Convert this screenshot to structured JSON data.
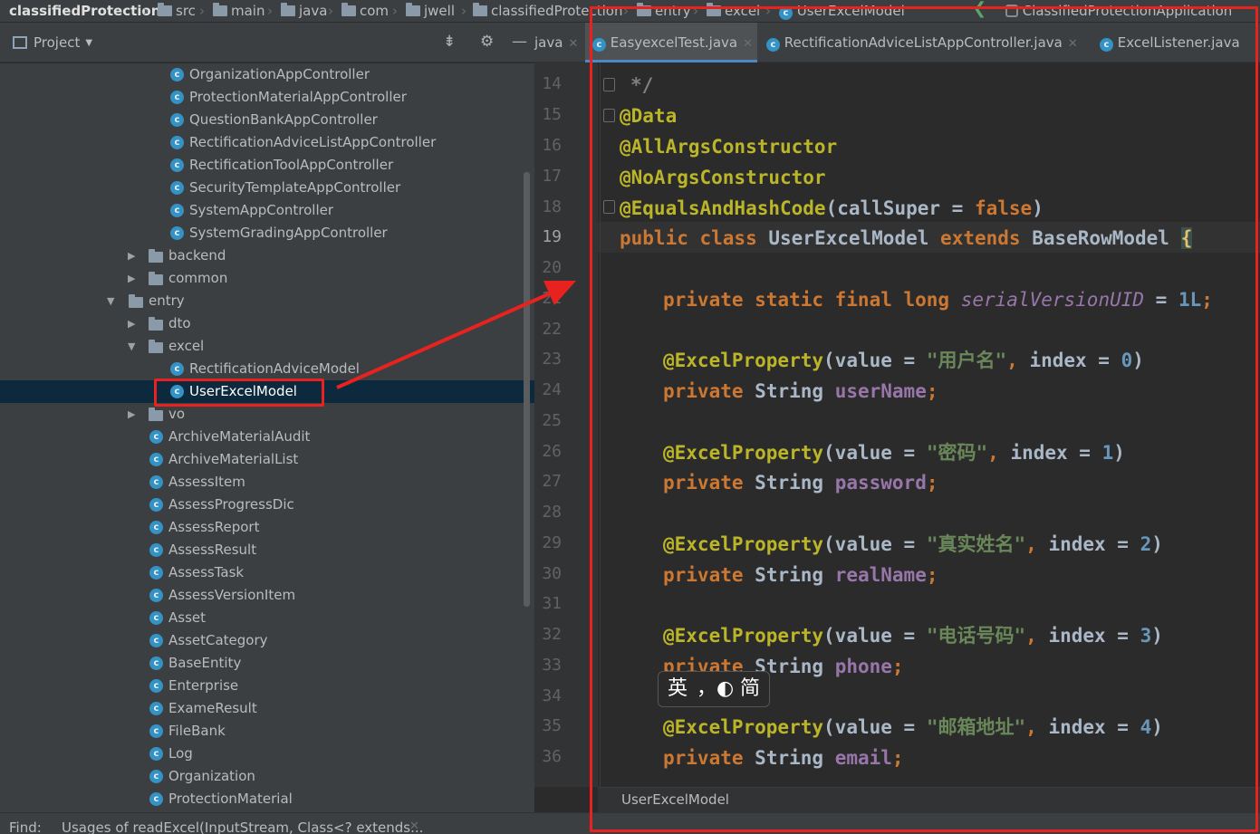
{
  "breadcrumbs": [
    "classifiedProtection",
    "src",
    "main",
    "java",
    "com",
    "jwell",
    "classifiedProtection",
    "entry",
    "excel",
    "UserExcelModel"
  ],
  "run_config": "ClassifiedProtectionApplication",
  "project_panel": {
    "title": "Project",
    "toolbar_java": "java",
    "tree": [
      {
        "label": "OrganizationAppController",
        "icon": "class-icon"
      },
      {
        "label": "ProtectionMaterialAppController",
        "icon": "class-icon"
      },
      {
        "label": "QuestionBankAppController",
        "icon": "class-icon"
      },
      {
        "label": "RectificationAdviceListAppController",
        "icon": "class-icon"
      },
      {
        "label": "RectificationToolAppController",
        "icon": "class-icon"
      },
      {
        "label": "SecurityTemplateAppController",
        "icon": "class-icon"
      },
      {
        "label": "SystemAppController",
        "icon": "class-icon"
      },
      {
        "label": "SystemGradingAppController",
        "icon": "class-icon"
      },
      {
        "label": "backend",
        "icon": "folder-icon"
      },
      {
        "label": "common",
        "icon": "folder-icon"
      },
      {
        "label": "entry",
        "icon": "folder-icon"
      },
      {
        "label": "dto",
        "icon": "folder-icon"
      },
      {
        "label": "excel",
        "icon": "folder-icon"
      },
      {
        "label": "RectificationAdviceModel",
        "icon": "class-icon"
      },
      {
        "label": "UserExcelModel",
        "icon": "class-icon"
      },
      {
        "label": "vo",
        "icon": "folder-icon"
      },
      {
        "label": "ArchiveMaterialAudit",
        "icon": "class-icon"
      },
      {
        "label": "ArchiveMaterialList",
        "icon": "class-icon"
      },
      {
        "label": "AssessItem",
        "icon": "class-icon"
      },
      {
        "label": "AssessProgressDic",
        "icon": "class-icon"
      },
      {
        "label": "AssessReport",
        "icon": "class-icon"
      },
      {
        "label": "AssessResult",
        "icon": "class-icon"
      },
      {
        "label": "AssessTask",
        "icon": "class-icon"
      },
      {
        "label": "AssessVersionItem",
        "icon": "class-icon"
      },
      {
        "label": "Asset",
        "icon": "class-icon"
      },
      {
        "label": "AssetCategory",
        "icon": "class-icon"
      },
      {
        "label": "BaseEntity",
        "icon": "class-icon"
      },
      {
        "label": "Enterprise",
        "icon": "class-icon"
      },
      {
        "label": "ExameResult",
        "icon": "class-icon"
      },
      {
        "label": "FileBank",
        "icon": "class-icon"
      },
      {
        "label": "Log",
        "icon": "class-icon"
      },
      {
        "label": "Organization",
        "icon": "class-icon"
      },
      {
        "label": "ProtectionMaterial",
        "icon": "class-icon"
      }
    ],
    "selected": "UserExcelModel"
  },
  "tabs": [
    {
      "label": "EasyexcelTest.java",
      "active": true
    },
    {
      "label": "RectificationAdviceListAppController.java",
      "active": false
    },
    {
      "label": "ExcelListener.java",
      "active": false
    }
  ],
  "editor": {
    "line_numbers": [
      "14",
      "15",
      "16",
      "17",
      "18",
      "19",
      "20",
      "21",
      "22",
      "23",
      "24",
      "25",
      "26",
      "27",
      "28",
      "29",
      "30",
      "31",
      "32",
      "33",
      "34",
      "35",
      "36"
    ],
    "current_line": "19",
    "code": {
      "l14": "*/",
      "l15": "@Data",
      "l16": "@AllArgsConstructor",
      "l17": "@NoArgsConstructor",
      "l18_ann": "@EqualsAndHashCode",
      "l18_arg": "callSuper",
      "l18_val": "false",
      "l19_kw": "public class",
      "l19_name": "UserExcelModel",
      "l19_ext": "extends",
      "l19_base": "BaseRowModel",
      "l21_mod": "private static final long",
      "l21_name": "serialVersionUID",
      "l21_val": "1L",
      "fields": [
        {
          "label": "用户名",
          "index": "0",
          "name": "userName"
        },
        {
          "label": "密码",
          "index": "1",
          "name": "password"
        },
        {
          "label": "真实姓名",
          "index": "2",
          "name": "realName"
        },
        {
          "label": "电话号码",
          "index": "3",
          "name": "phone"
        },
        {
          "label": "邮箱地址",
          "index": "4",
          "name": "email"
        }
      ],
      "annotation": "@ExcelProperty",
      "value_kw": "value",
      "index_kw": "index",
      "private_kw": "private",
      "type": "String"
    },
    "status_breadcrumb": "UserExcelModel"
  },
  "ime": {
    "mode": "英",
    "punct": "，",
    "moon": "◐",
    "script": "简"
  },
  "find_bar": {
    "label": "Find:",
    "value": "Usages of readExcel(InputStream, Class<? extends..."
  },
  "annotation_color": "#e8231f"
}
